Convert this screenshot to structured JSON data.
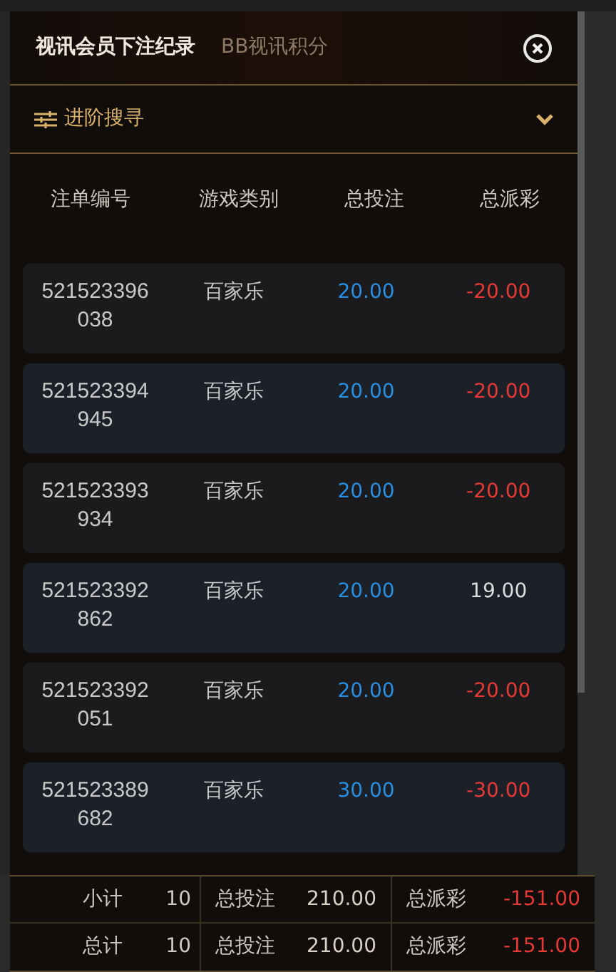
{
  "tabs": [
    {
      "label": "视讯会员下注纪录",
      "selected": true
    },
    {
      "label": "BB视讯积分",
      "selected": false
    }
  ],
  "advanced_search": {
    "label": "进阶搜寻",
    "expanded": false
  },
  "table": {
    "columns": [
      "注单编号",
      "游戏类别",
      "总投注",
      "总派彩"
    ],
    "rows": [
      {
        "id": "521523396038",
        "game": "百家乐",
        "bet": "20.00",
        "payout": "-20.00",
        "color": "#e53935"
      },
      {
        "id": "521523394945",
        "game": "百家乐",
        "bet": "20.00",
        "payout": "-20.00",
        "color": "#e53935"
      },
      {
        "id": "521523393934",
        "game": "百家乐",
        "bet": "20.00",
        "payout": "-20.00",
        "color": "#e53935"
      },
      {
        "id": "521523392862",
        "game": "百家乐",
        "bet": "20.00",
        "payout": "19.00",
        "color": "#dddddd"
      },
      {
        "id": "521523392051",
        "game": "百家乐",
        "bet": "20.00",
        "payout": "-20.00",
        "color": "#e53935"
      },
      {
        "id": "521523389682",
        "game": "百家乐",
        "bet": "30.00",
        "payout": "-30.00",
        "color": "#e53935"
      }
    ]
  },
  "summary": [
    {
      "label": "小计",
      "count": "10",
      "bet_label": "总投注",
      "bet": "210.00",
      "payout_label": "总派彩",
      "payout": "-151.00"
    },
    {
      "label": "总计",
      "count": "10",
      "bet_label": "总投注",
      "bet": "210.00",
      "payout_label": "总派彩",
      "payout": "-151.00"
    }
  ]
}
